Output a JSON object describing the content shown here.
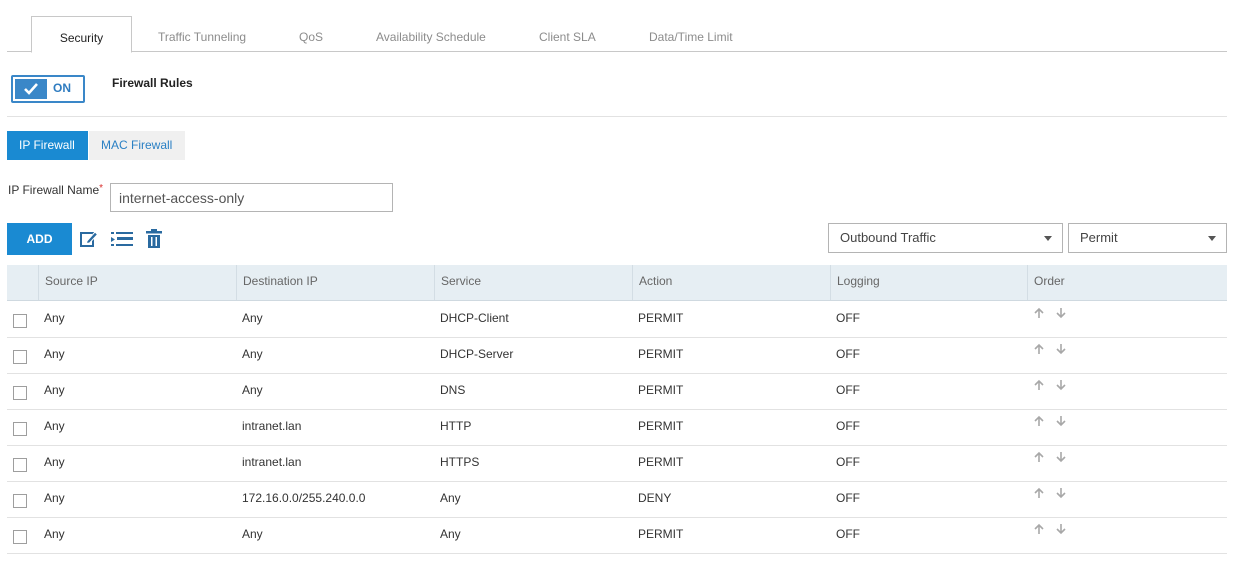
{
  "tabs": [
    {
      "label": "Security"
    },
    {
      "label": "Traffic Tunneling"
    },
    {
      "label": "QoS"
    },
    {
      "label": "Availability Schedule"
    },
    {
      "label": "Client SLA"
    },
    {
      "label": "Data/Time Limit"
    }
  ],
  "toggle": {
    "label": "ON",
    "icon": "check-icon"
  },
  "firewall_rules_title": "Firewall Rules",
  "subtabs": {
    "ip": "IP Firewall",
    "mac": "MAC Firewall"
  },
  "name_field": {
    "label": "IP Firewall Name",
    "required_mark": "*",
    "value": "internet-access-only"
  },
  "toolbar": {
    "add_label": "ADD",
    "icons": [
      "edit-icon",
      "list-icon",
      "trash-icon"
    ],
    "direction_select": "Outbound Traffic",
    "action_select": "Permit"
  },
  "table": {
    "columns": [
      "Source IP",
      "Destination IP",
      "Service",
      "Action",
      "Logging",
      "Order"
    ],
    "rows": [
      {
        "source": "Any",
        "destination": "Any",
        "service": "DHCP-Client",
        "action": "PERMIT",
        "logging": "OFF"
      },
      {
        "source": "Any",
        "destination": "Any",
        "service": "DHCP-Server",
        "action": "PERMIT",
        "logging": "OFF"
      },
      {
        "source": "Any",
        "destination": "Any",
        "service": "DNS",
        "action": "PERMIT",
        "logging": "OFF"
      },
      {
        "source": "Any",
        "destination": "intranet.lan",
        "service": "HTTP",
        "action": "PERMIT",
        "logging": "OFF"
      },
      {
        "source": "Any",
        "destination": "intranet.lan",
        "service": "HTTPS",
        "action": "PERMIT",
        "logging": "OFF"
      },
      {
        "source": "Any",
        "destination": "172.16.0.0/255.240.0.0",
        "service": "Any",
        "action": "DENY",
        "logging": "OFF"
      },
      {
        "source": "Any",
        "destination": "Any",
        "service": "Any",
        "action": "PERMIT",
        "logging": "OFF"
      }
    ]
  },
  "colors": {
    "accent": "#1a8ad2",
    "toggle": "#3a87c8",
    "header_bg": "#e6eef3",
    "required": "#d9302f"
  }
}
